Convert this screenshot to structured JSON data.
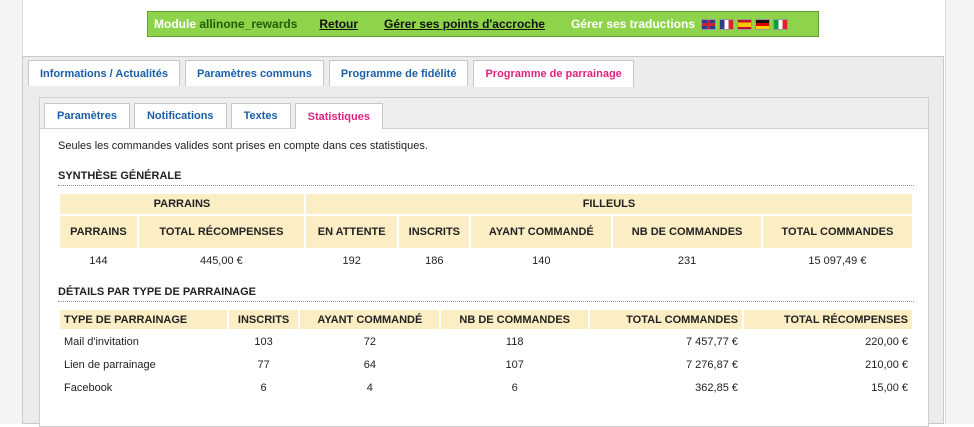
{
  "topbar": {
    "module_prefix": "Module ",
    "module_name": "allinone_rewards",
    "back": "Retour",
    "hooks": "Gérer ses points d'accroche",
    "translations": "Gérer ses traductions",
    "flags": [
      "gb-flag-icon",
      "fr-flag-icon",
      "es-flag-icon",
      "de-flag-icon",
      "it-flag-icon"
    ]
  },
  "main_tabs": [
    {
      "label": "Informations / Actualités"
    },
    {
      "label": "Paramètres communs"
    },
    {
      "label": "Programme de fidélité"
    },
    {
      "label": "Programme de parrainage",
      "active": true
    }
  ],
  "sub_tabs": [
    {
      "label": "Paramètres"
    },
    {
      "label": "Notifications"
    },
    {
      "label": "Textes"
    },
    {
      "label": "Statistiques",
      "active": true
    }
  ],
  "note": "Seules les commandes valides sont prises en compte dans ces statistiques.",
  "summary": {
    "title": "SYNTHÈSE GÉNÉRALE",
    "group_parrains": "PARRAINS",
    "group_filleuls": "FILLEULS",
    "headers": [
      "PARRAINS",
      "TOTAL RÉCOMPENSES",
      "EN ATTENTE",
      "INSCRITS",
      "AYANT COMMANDÉ",
      "NB DE COMMANDES",
      "TOTAL COMMANDES"
    ],
    "values": [
      "144",
      "445,00 €",
      "192",
      "186",
      "140",
      "231",
      "15 097,49 €"
    ]
  },
  "details": {
    "title": "DÉTAILS PAR TYPE DE PARRAINAGE",
    "headers": [
      "TYPE DE PARRAINAGE",
      "INSCRITS",
      "AYANT COMMANDÉ",
      "NB DE COMMANDES",
      "TOTAL COMMANDES",
      "TOTAL RÉCOMPENSES"
    ],
    "rows": [
      [
        "Mail d'invitation",
        "103",
        "72",
        "118",
        "7 457,77 €",
        "220,00 €"
      ],
      [
        "Lien de parrainage",
        "77",
        "64",
        "107",
        "7 276,87 €",
        "210,00 €"
      ],
      [
        "Facebook",
        "6",
        "4",
        "6",
        "362,85 €",
        "15,00 €"
      ]
    ]
  },
  "colors": {
    "topbar": "#8ed44b",
    "link_blue": "#1b5fa6",
    "active_pink": "#e0237f",
    "header_cell": "#fbedc4"
  }
}
